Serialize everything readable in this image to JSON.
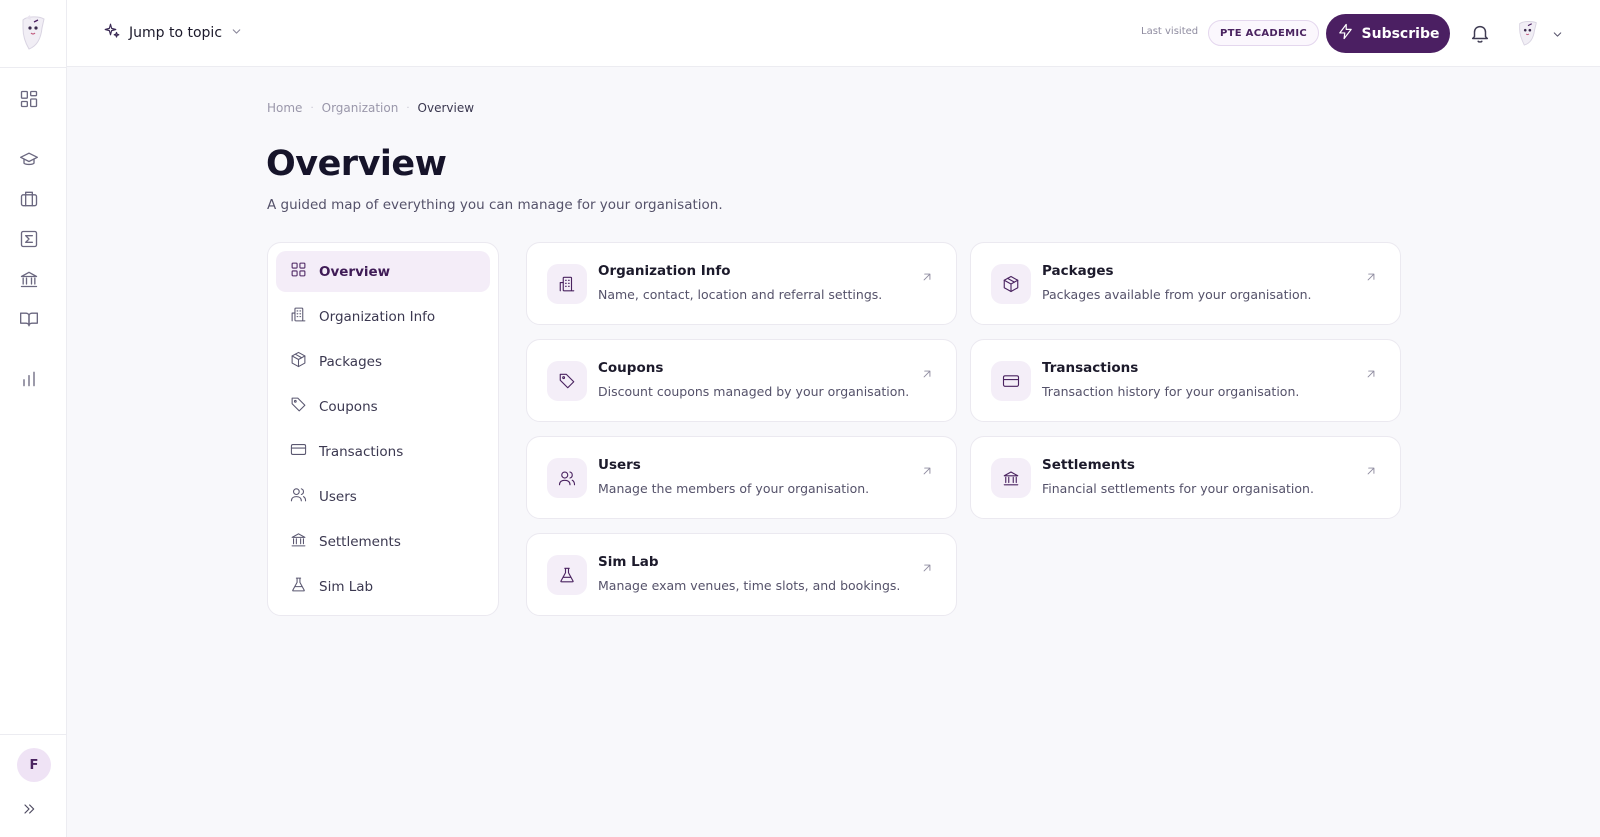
{
  "topbar": {
    "jump_label": "Jump to topic",
    "last_visited_label": "Last visited",
    "course_badge": "PTE ACADEMIC",
    "subscribe_label": "Subscribe"
  },
  "rail": {
    "avatar_initial": "F",
    "icons": [
      "dashboard-icon",
      "graduation-cap-icon",
      "briefcase-icon",
      "sigma-icon",
      "bank-icon",
      "book-icon",
      "bar-chart-icon"
    ]
  },
  "breadcrumb": {
    "items": [
      "Home",
      "Organization",
      "Overview"
    ],
    "separator": "·"
  },
  "page": {
    "title": "Overview",
    "subtitle": "A guided map of everything you can manage for your organisation."
  },
  "side_menu": {
    "items": [
      {
        "label": "Overview",
        "icon": "grid-icon",
        "active": true
      },
      {
        "label": "Organization Info",
        "icon": "building-icon",
        "active": false
      },
      {
        "label": "Packages",
        "icon": "package-icon",
        "active": false
      },
      {
        "label": "Coupons",
        "icon": "tag-icon",
        "active": false
      },
      {
        "label": "Transactions",
        "icon": "credit-card-icon",
        "active": false
      },
      {
        "label": "Users",
        "icon": "users-icon",
        "active": false
      },
      {
        "label": "Settlements",
        "icon": "bank-icon",
        "active": false
      },
      {
        "label": "Sim Lab",
        "icon": "flask-icon",
        "active": false
      }
    ]
  },
  "cards": [
    {
      "title": "Organization Info",
      "description": "Name, contact, location and referral settings.",
      "icon": "building-icon"
    },
    {
      "title": "Packages",
      "description": "Packages available from your organisation.",
      "icon": "package-icon"
    },
    {
      "title": "Coupons",
      "description": "Discount coupons managed by your organisation.",
      "icon": "tag-icon"
    },
    {
      "title": "Transactions",
      "description": "Transaction history for your organisation.",
      "icon": "credit-card-icon"
    },
    {
      "title": "Users",
      "description": "Manage the members of your organisation.",
      "icon": "users-icon"
    },
    {
      "title": "Settlements",
      "description": "Financial settlements for your organisation.",
      "icon": "bank-icon"
    },
    {
      "title": "Sim Lab",
      "description": "Manage exam venues, time slots, and bookings.",
      "icon": "flask-icon"
    }
  ],
  "colors": {
    "brand": "#4b1f62",
    "active_bg": "#f4edf8",
    "icon_tile_bg": "#f4eef8"
  }
}
